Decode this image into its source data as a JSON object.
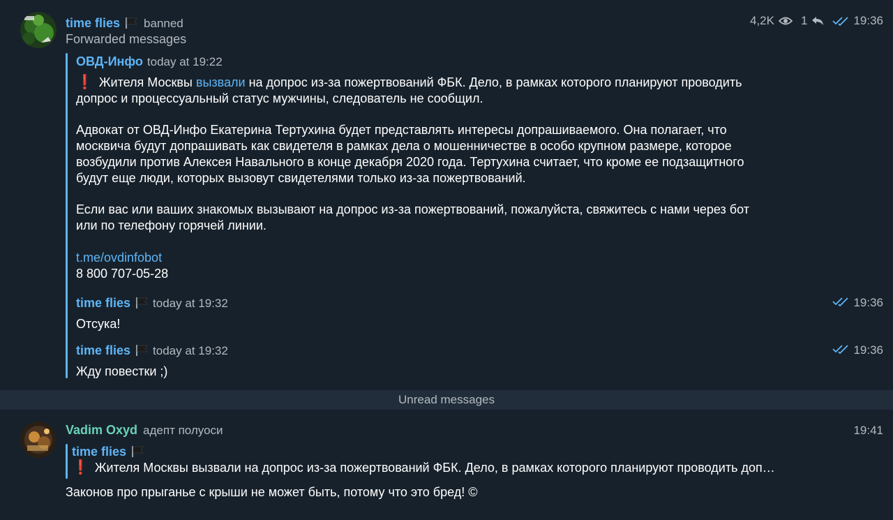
{
  "colors": {
    "background": "#17212b",
    "accent": "#5eb5f7",
    "green_name": "#6ad2b6",
    "muted": "#b3b9c0",
    "unread_bar": "#212d3b"
  },
  "message1": {
    "sender": "time flies",
    "flag_icon": "black-flag-icon",
    "badge": "banned",
    "subtitle": "Forwarded messages",
    "views": "4,2K",
    "replies": "1",
    "time": "19:36",
    "forwarded": {
      "source": "ОВД-Инфо",
      "source_time": "today at 19:22",
      "line1_pre": "Жителя Москвы ",
      "line1_link": "вызвали",
      "line1_post": " на допрос из-за пожертвований ФБК. Дело, в рамках которого планируют проводить",
      "line2": "допрос и процессуальный статус мужчины, следователь не сообщил.",
      "para2": [
        "Адвокат от ОВД-Инфо Екатерина Тертухина будет представлять интересы допрашиваемого. Она полагает, что",
        "москвича будут допрашивать как свидетеля в рамках дела о мошенничестве в особо крупном размере, которое",
        "возбудили против Алексея Навального в конце декабря 2020 года. Тертухина считает, что кроме ее подзащитного",
        "будут еще люди, которых вызовут свидетелями только из-за пожертвований."
      ],
      "para3": [
        "Если вас или ваших знакомых вызывают на допрос из-за пожертвований, пожалуйста, свяжитесь с нами через бот",
        "или по телефону горячей линии."
      ],
      "link": "t.me/ovdinfobot",
      "phone": "8 800 707-05-28"
    },
    "sub_messages": [
      {
        "sender": "time flies",
        "time_label": "today at 19:32",
        "text": "Отсука!",
        "time": "19:36"
      },
      {
        "sender": "time flies",
        "time_label": "today at 19:32",
        "text": "Жду повестки ;)",
        "time": "19:36"
      }
    ]
  },
  "unread_label": "Unread messages",
  "message2": {
    "sender": "Vadim Oxyd",
    "badge": "адепт полуоси",
    "time": "19:41",
    "reply": {
      "sender": "time flies",
      "text": "Жителя Москвы вызвали на допрос из-за пожертвований ФБК. Дело, в рамках которого планируют проводить доп…"
    },
    "text": "Законов про прыганье с крыши не может быть, потому что это бред! ©"
  }
}
